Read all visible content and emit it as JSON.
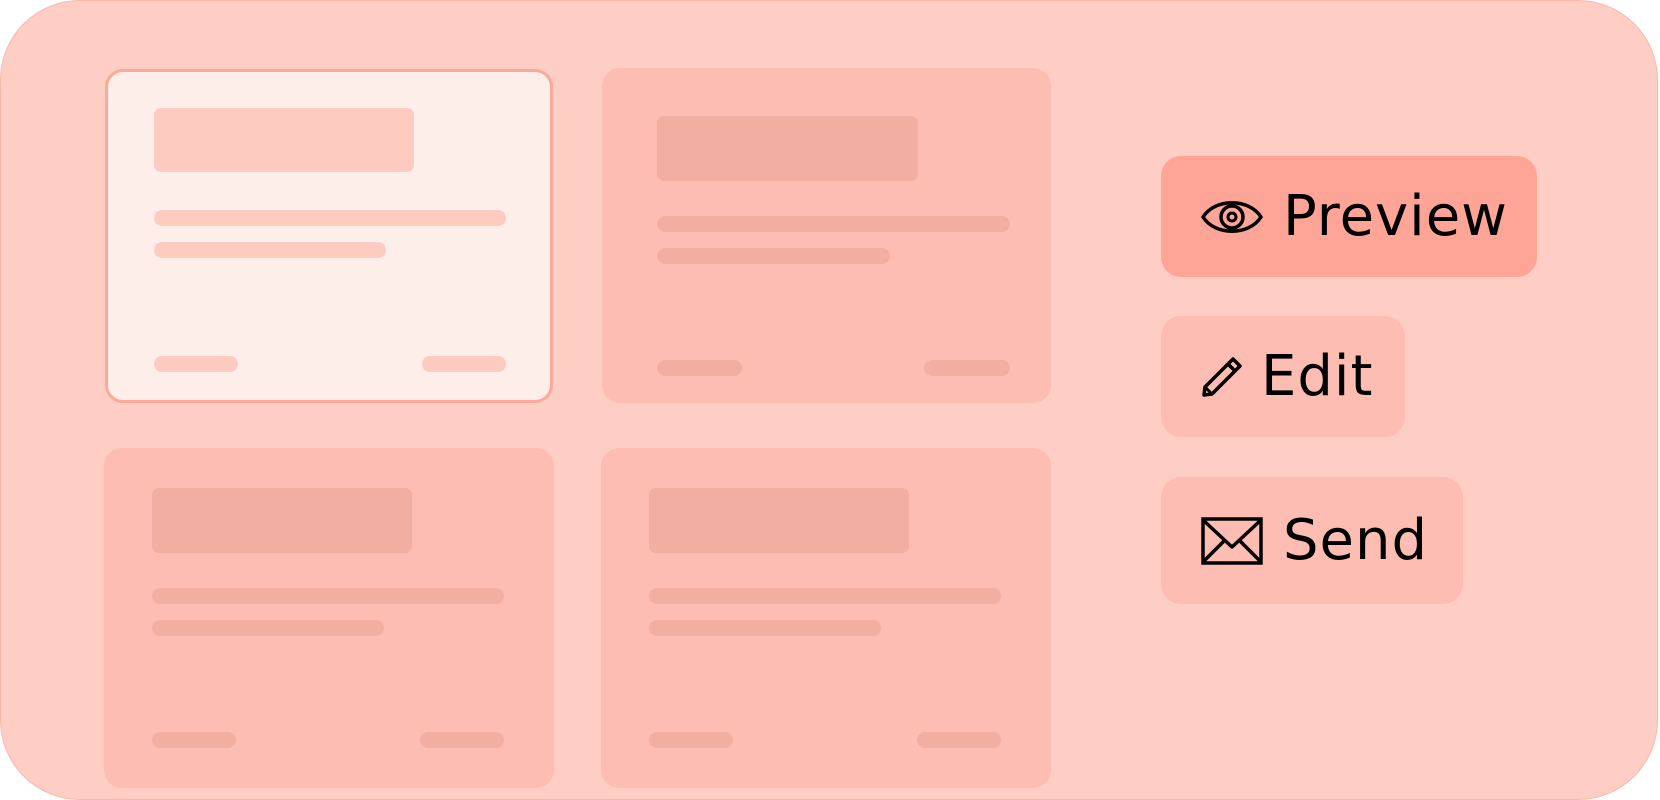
{
  "theme": {
    "background": "#fecdc4",
    "card": "#febdb2",
    "card_selected": "#fdeeea",
    "selected_border": "#fca89b",
    "primary_button": "#fea597",
    "button": "#febdb2"
  },
  "cards": [
    {
      "name": "template-card-1",
      "selected": true
    },
    {
      "name": "template-card-2",
      "selected": false
    },
    {
      "name": "template-card-3",
      "selected": false
    },
    {
      "name": "template-card-4",
      "selected": false
    }
  ],
  "actions": {
    "preview": {
      "label": "Preview",
      "icon": "eye-icon"
    },
    "edit": {
      "label": "Edit",
      "icon": "pencil-icon"
    },
    "send": {
      "label": "Send",
      "icon": "envelope-icon"
    }
  }
}
